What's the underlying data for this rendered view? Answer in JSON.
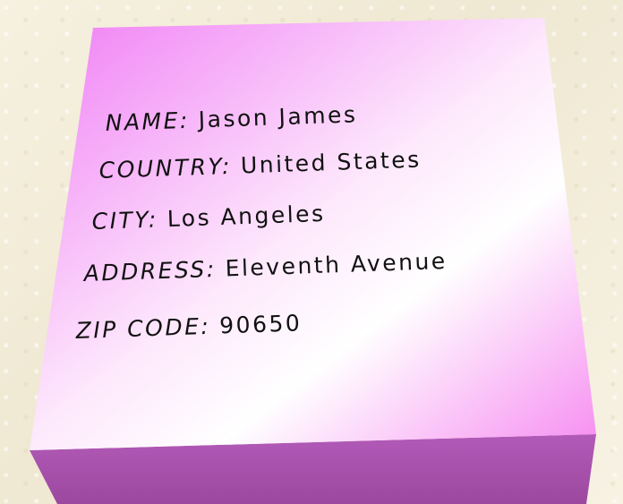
{
  "card": {
    "colors": {
      "top_start": "#f07cf5",
      "top_mid": "#ffffff",
      "top_end": "#f58cf3",
      "side": "#a34ea8",
      "background": "#f4efdc"
    },
    "fields": [
      {
        "label": "NAME:",
        "value": "Jason James"
      },
      {
        "label": "COUNTRY:",
        "value": "United States"
      },
      {
        "label": "CITY:",
        "value": "Los Angeles"
      },
      {
        "label": "ADDRESS:",
        "value": "Eleventh Avenue"
      },
      {
        "label": "ZIP CODE:",
        "value": "90650"
      }
    ]
  }
}
